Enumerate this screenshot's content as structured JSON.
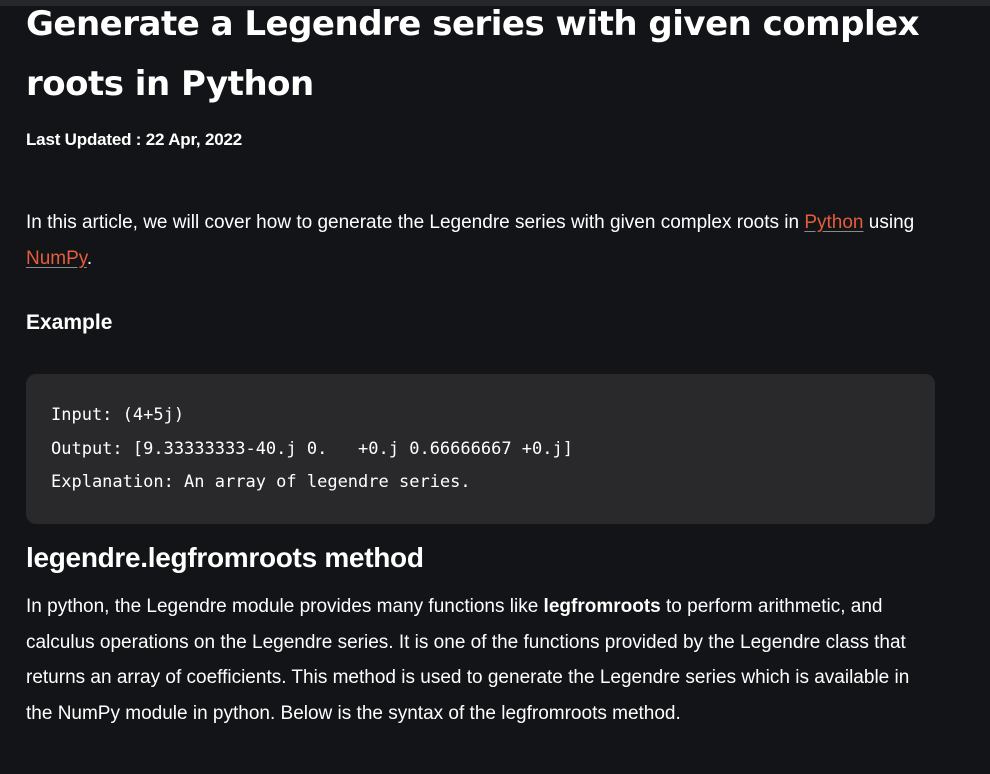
{
  "article": {
    "title": "Generate a Legendre series with given complex roots in Python",
    "last_updated_label": "Last Updated : ",
    "last_updated_date": "22 Apr, 2022",
    "intro": {
      "before_python": "In this article, we will cover how to generate the Legendre series with given complex roots in ",
      "python_link": "Python",
      "between": " using ",
      "numpy_link": "NumPy",
      "after": "."
    },
    "example_heading": "Example",
    "code_lines": [
      "Input: (4+5j)",
      "Output: [9.33333333-40.j 0.   +0.j 0.66666667 +0.j]",
      "Explanation: An array of legendre series."
    ],
    "method_heading": "legendre.legfromroots method",
    "method_body": {
      "before_bold": "In python, the Legendre module provides many functions like ",
      "bold": "legfromroots",
      "after_bold": " to perform arithmetic, and calculus operations on the Legendre series. It is one of the functions provided by the Legendre class that returns an array of coefficients. This method is used to generate the Legendre series which is available in the NumPy module in python. Below is the syntax of the legfromroots method."
    }
  },
  "colors": {
    "background": "#131417",
    "text": "#ffffff",
    "link": "#e45d3c",
    "code_background": "#29292c"
  }
}
